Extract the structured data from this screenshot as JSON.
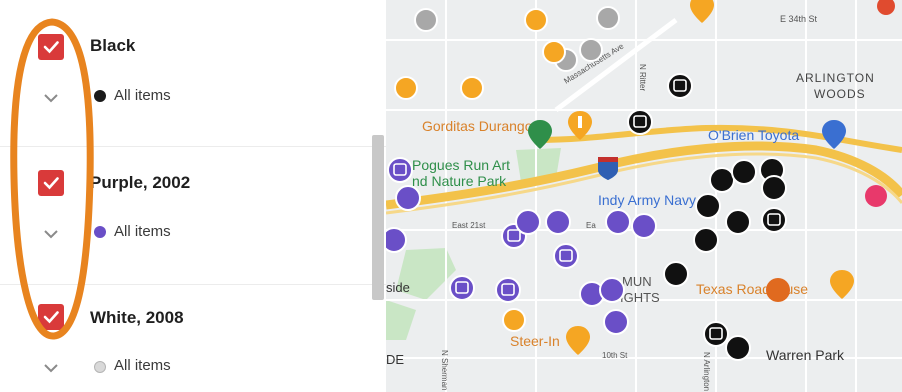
{
  "layers": [
    {
      "name": "Black",
      "checked": true,
      "items_label": "All items",
      "dot_color": "#1a1a1a"
    },
    {
      "name": "Purple, 2002",
      "checked": true,
      "items_label": "All items",
      "dot_color": "#6a4fc7"
    },
    {
      "name": "White, 2008",
      "checked": true,
      "items_label": "All items",
      "dot_color": "#d9d9d9"
    }
  ],
  "map": {
    "labels": {
      "e34": "E 34th St",
      "arlington": "ARLINGTON",
      "woods": "WOODS",
      "massachusetts": "Massachusetts Ave",
      "nritter": "N Ritter",
      "gorditas": "Gorditas Durango!",
      "obrien": "O'Brien Toyota",
      "pogues1": "Pogues Run Art",
      "pogues2": "nd Nature Park",
      "indy": "Indy Army Navy",
      "e21": "East 21st",
      "ea": "Ea",
      "texas": "Texas Roadhouse",
      "steer": "Steer-In",
      "warren": "Warren Park",
      "side": "side",
      "de": "DE",
      "mun": "MUN",
      "ights": "IGHTS",
      "tenth": "10th St",
      "sherman": "N Sherman",
      "nav": "N Arlington"
    },
    "colors": {
      "black_pin": "#111111",
      "purple_pin": "#6a4fc7",
      "grey_pin": "#a8a8a8",
      "orange_pin": "#f5a623",
      "route": "#f3c24a",
      "annotation": "#e8841f",
      "park": "#c9e6c5"
    }
  }
}
